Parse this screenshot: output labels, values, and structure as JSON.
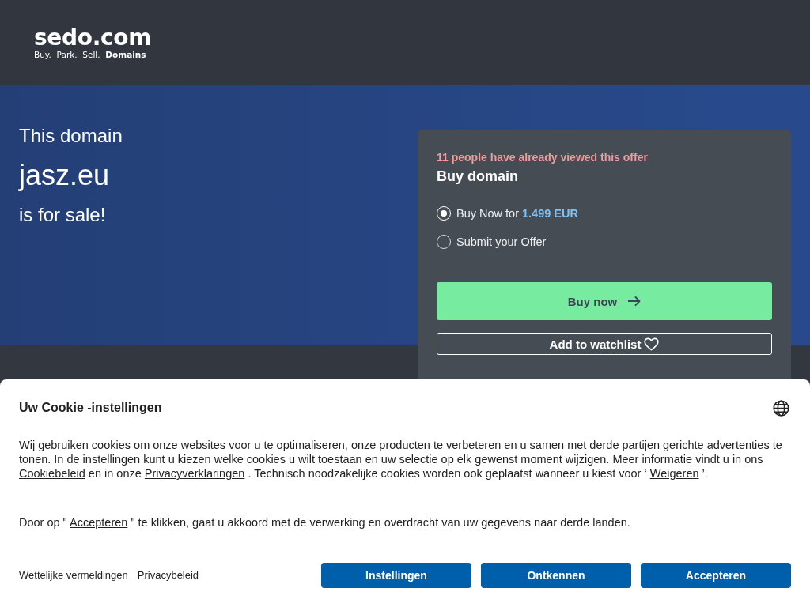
{
  "header": {
    "logo": {
      "wordmark": "sedo.com",
      "tagline": "Buy.  Park.  Sell.  **Domains**"
    }
  },
  "hero": {
    "intro": "This domain",
    "domain": "jasz.eu",
    "outro": "is for sale!"
  },
  "offer_card": {
    "notice": "11 people have already viewed this offer",
    "title": "Buy domain",
    "options": [
      {
        "label": "Buy Now for **1.499 EUR**",
        "selected": true
      },
      {
        "label": "Submit your Offer",
        "selected": false
      }
    ],
    "buy_button": "Buy now",
    "watchlist_button": "Add to watchlist"
  },
  "cookie_banner": {
    "title": "Uw Cookie -instellingen",
    "paragraphs": [
      [
        {
          "kind": "text",
          "text": "Wij gebruiken cookies om onze websites voor u te optimaliseren, onze producten te verbeteren en u samen met derde partijen gerichte advertenties te tonen. In de instellingen kunt u kiezen welke cookies u wilt toestaan en uw selectie op elk gewenst moment wijzigen. Meer informatie vindt u in ons "
        },
        {
          "kind": "link",
          "text": "Cookiebeleid"
        },
        {
          "kind": "text",
          "text": " en in onze "
        },
        {
          "kind": "link",
          "text": "Privacyverklaringen"
        },
        {
          "kind": "text",
          "text": " . Technisch noodzakelijke cookies worden ook geplaatst wanneer u kiest voor ‘ "
        },
        {
          "kind": "link",
          "text": "Weigeren"
        },
        {
          "kind": "text",
          "text": " ’."
        }
      ],
      [
        {
          "kind": "text",
          "text": "Door op \" "
        },
        {
          "kind": "link",
          "text": "Accepteren"
        },
        {
          "kind": "text",
          "text": " \" te klikken, gaat u akkoord met de verwerking en overdracht van uw gegevens naar derde landen."
        }
      ]
    ],
    "footer_links": [
      "Wettelijke vermeldingen",
      "Privacybeleid"
    ],
    "buttons": [
      "Instellingen",
      "Ontkennen",
      "Accepteren"
    ]
  }
}
